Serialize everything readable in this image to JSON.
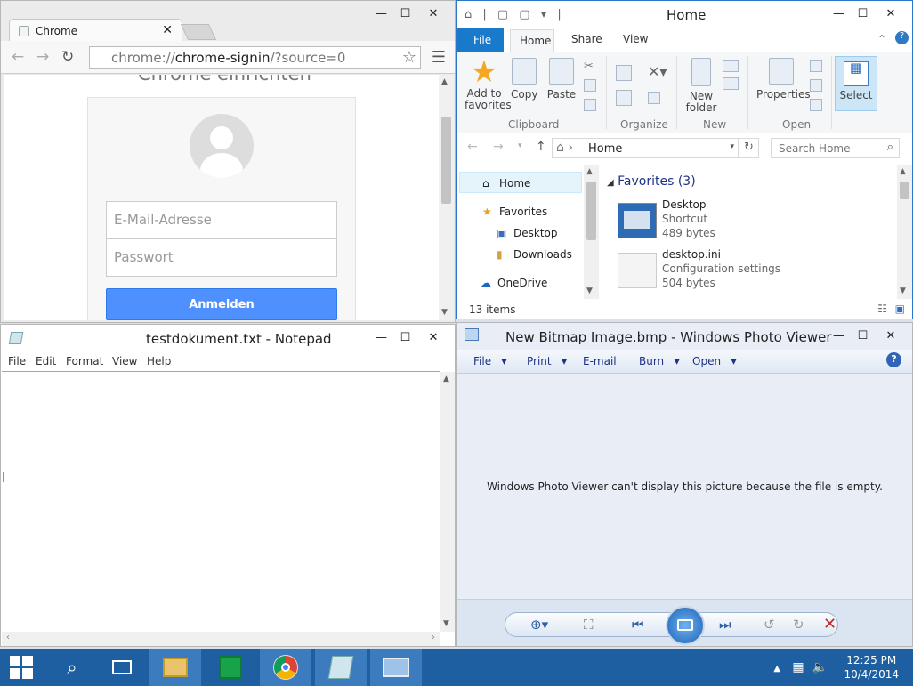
{
  "chrome": {
    "window_title": "",
    "tab_label": "Chrome",
    "address_prefix": "chrome://",
    "address_host": "chrome-signin",
    "address_rest": "/?source=0",
    "page_heading_partial": "Chrome einrichten",
    "email_placeholder": "E-Mail-Adresse",
    "password_placeholder": "Passwort",
    "signin_label": "Anmelden"
  },
  "explorer": {
    "title": "Home",
    "tabs": {
      "file": "File",
      "home": "Home",
      "share": "Share",
      "view": "View"
    },
    "ribbon": {
      "add_to_favorites": "Add to favorites",
      "copy": "Copy",
      "paste": "Paste",
      "new_folder": "New folder",
      "properties": "Properties",
      "select": "Select",
      "groups": [
        "Clipboard",
        "Organize",
        "New",
        "Open"
      ]
    },
    "address": "Home",
    "search_placeholder": "Search Home",
    "nav": [
      "Home",
      "Favorites",
      "Desktop",
      "Downloads",
      "OneDrive"
    ],
    "group_header": "Favorites (3)",
    "items": [
      {
        "name": "Desktop",
        "type": "Shortcut",
        "size": "489 bytes"
      },
      {
        "name": "desktop.ini",
        "type": "Configuration settings",
        "size": "504 bytes"
      }
    ],
    "status": "13 items"
  },
  "notepad": {
    "title": "testdokument.txt - Notepad",
    "menu": [
      "File",
      "Edit",
      "Format",
      "View",
      "Help"
    ]
  },
  "photo": {
    "title": "New Bitmap Image.bmp - Windows Photo Viewer",
    "menu": [
      "File",
      "Print",
      "E-mail",
      "Burn",
      "Open"
    ],
    "message": "Windows Photo Viewer can't display this picture because the file is empty."
  },
  "taskbar": {
    "time": "12:25 PM",
    "date": "10/4/2014"
  },
  "colors": {
    "accent": "#1979ca",
    "taskbar": "#1e5fa1",
    "signin": "#4d90fe"
  }
}
